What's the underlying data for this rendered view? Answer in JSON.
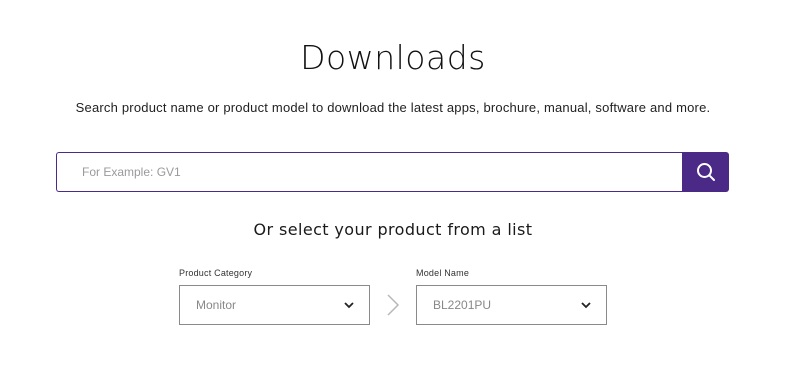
{
  "page": {
    "title": "Downloads",
    "subtitle": "Search product name or product model to download the latest apps, brochure, manual, software and more."
  },
  "search": {
    "placeholder": "For Example: GV1",
    "value": "",
    "button_icon": "search-icon"
  },
  "product_list": {
    "heading": "Or select your product from a list",
    "category": {
      "label": "Product Category",
      "selected": "Monitor"
    },
    "model": {
      "label": "Model Name",
      "selected": "BL2201PU"
    },
    "separator_icon": "chevron-right-icon"
  },
  "colors": {
    "accent": "#4b2a87",
    "border": "#8a8a8a",
    "text": "#1a1a1a",
    "muted": "#888888"
  }
}
